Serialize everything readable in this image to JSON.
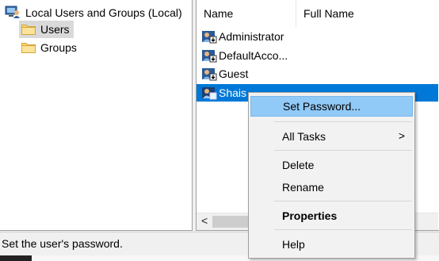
{
  "tree": {
    "root_label": "Local Users and Groups (Local)",
    "items": [
      {
        "label": "Users"
      },
      {
        "label": "Groups"
      }
    ]
  },
  "list": {
    "columns": [
      "Name",
      "Full Name"
    ],
    "rows": [
      {
        "name": "Administrator"
      },
      {
        "name": "DefaultAcco..."
      },
      {
        "name": "Guest"
      },
      {
        "name": "Shais"
      }
    ],
    "selected_row": "Shais"
  },
  "scrollbar": {
    "left_arrow": "<"
  },
  "context_menu": {
    "items": [
      {
        "label": "Set Password..."
      },
      {
        "label": "All Tasks",
        "submenu_arrow": ">"
      },
      {
        "label": "Delete"
      },
      {
        "label": "Rename"
      },
      {
        "label": "Properties"
      },
      {
        "label": "Help"
      }
    ]
  },
  "status_bar": {
    "text": "Set the user's password."
  },
  "colors": {
    "selection": "#0078d7",
    "menu_highlight": "#91c9f7",
    "tree_selected": "#d9d9d9"
  }
}
